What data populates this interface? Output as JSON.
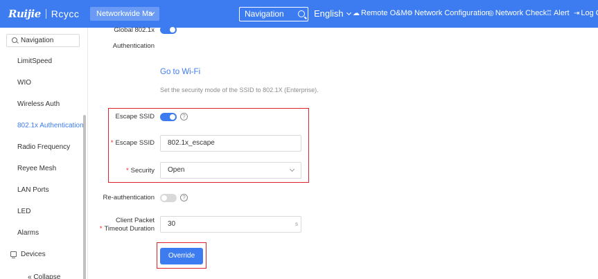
{
  "header": {
    "brand_primary": "Ruijie",
    "brand_secondary": "Rcycc",
    "network_selector": "Networkwide Ma",
    "nav_search": "Navigation",
    "language": "English",
    "links": [
      "Remote O&M",
      "Network Configuration",
      "Network Check",
      "Alert",
      "Log O"
    ]
  },
  "sidebar": {
    "search_placeholder": "Navigation",
    "items": [
      "LimitSpeed",
      "WIO",
      "Wireless Auth",
      "802.1x Authentication",
      "Radio Frequency",
      "Reyee Mesh",
      "LAN Ports",
      "LED",
      "Alarms"
    ],
    "active": "802.1x Authentication",
    "devices": "Devices",
    "collapse": "« Collapse"
  },
  "form": {
    "global_label_line1": "Global 802.1x",
    "global_label_line2": "Authentication",
    "go_to_wifi": "Go to Wi-Fi",
    "hint": "Set the security mode of the SSID to 802.1X (Enterprise).",
    "escape_ssid_toggle_label": "Escape SSID",
    "escape_ssid_input_label": "Escape SSID",
    "escape_ssid_value": "802.1x_escape",
    "security_label": "Security",
    "security_value": "Open",
    "reauth_label": "Re-authentication",
    "timeout_label_line1": "Client Packet",
    "timeout_label_line2": "Timeout Duration",
    "timeout_value": "30",
    "timeout_unit": "s",
    "override_button": "Override",
    "required_mark": "*",
    "help_glyph": "?"
  },
  "colors": {
    "primary": "#3d7cf0",
    "highlight_box": "#e0202a"
  }
}
